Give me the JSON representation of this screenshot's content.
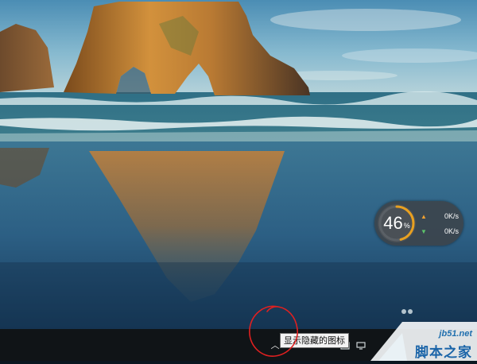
{
  "widget": {
    "percent": "46",
    "percent_unit": "%",
    "usage_level": 0.46,
    "upload_speed": "0K/s",
    "download_speed": "0K/s",
    "upload_color": "#f0a030",
    "download_color": "#5cc36a"
  },
  "taskbar": {
    "tooltip": "显示隐藏的图标",
    "chevron_icon": "chevron-up-icon",
    "tray_icons": [
      "tray-app-icon",
      "tray-monitor-icon"
    ]
  },
  "watermark": {
    "domain": "jb51.net",
    "brand": "脚本之家"
  },
  "annotation": {
    "color": "#e02020"
  }
}
